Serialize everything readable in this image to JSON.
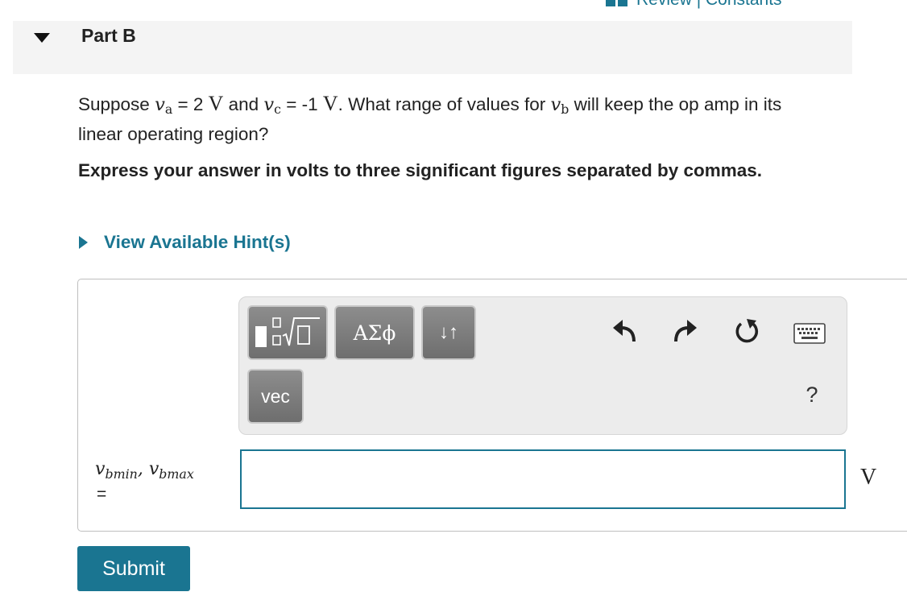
{
  "header": {
    "review_label": "Review | Constants"
  },
  "part": {
    "title": "Part B"
  },
  "question": {
    "prefix": "Suppose",
    "va_symbol": "v",
    "va_sub": "a",
    "eq": "=",
    "va_value": "2",
    "va_unit": "V",
    "and": "and",
    "vc_symbol": "v",
    "vc_sub": "c",
    "vc_value": "-1",
    "vc_unit": "V",
    "mid": ". What range of values for",
    "vb_symbol": "v",
    "vb_sub": "b",
    "suffix": "will keep the op amp in its linear operating region?"
  },
  "instruction": "Express your answer in volts to three significant figures separated by commas.",
  "hint": {
    "label": "View Available Hint(s)"
  },
  "toolbar": {
    "templates_icon": "fraction-root-template-icon",
    "greek_label": "ΑΣϕ",
    "arrows_label": "↓↑",
    "vec_label": "vec",
    "undo_icon": "undo-icon",
    "redo_icon": "redo-icon",
    "reset_icon": "reset-icon",
    "keyboard_icon": "keyboard-icon",
    "help_label": "?"
  },
  "answer": {
    "label_var1": "v",
    "label_sub1": "bmin",
    "label_sep": ",",
    "label_var2": "v",
    "label_sub2": "bmax",
    "equals": "=",
    "value": "",
    "unit": "V"
  },
  "submit_label": "Submit",
  "colors": {
    "accent": "#1a7591",
    "header_bg": "#f4f4f4",
    "button_gray": "#7a7a7a"
  }
}
